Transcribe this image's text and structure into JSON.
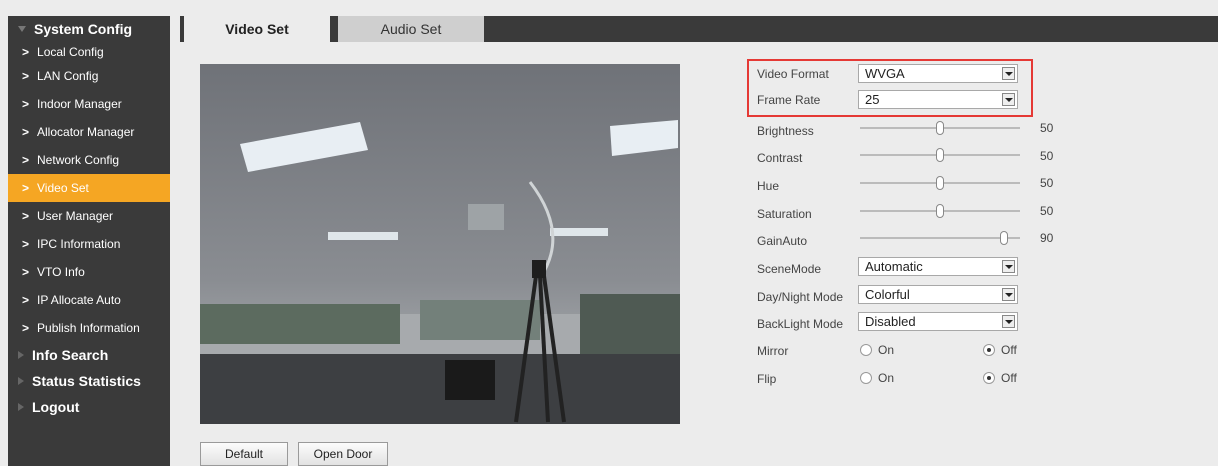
{
  "sidebar": {
    "system_config": "System Config",
    "items": [
      {
        "label": "Local Config"
      },
      {
        "label": "LAN Config"
      },
      {
        "label": "Indoor Manager"
      },
      {
        "label": "Allocator Manager"
      },
      {
        "label": "Network Config"
      },
      {
        "label": "Video Set"
      },
      {
        "label": "User Manager"
      },
      {
        "label": "IPC Information"
      },
      {
        "label": "VTO Info"
      },
      {
        "label": "IP Allocate Auto"
      },
      {
        "label": "Publish Information"
      }
    ],
    "info_search": "Info Search",
    "status_statistics": "Status Statistics",
    "logout": "Logout",
    "chevron": ">"
  },
  "tabs": {
    "video_set": "Video Set",
    "audio_set": "Audio Set"
  },
  "settings": {
    "video_format": {
      "label": "Video Format",
      "value": "WVGA"
    },
    "frame_rate": {
      "label": "Frame Rate",
      "value": "25"
    },
    "brightness": {
      "label": "Brightness",
      "value": 50,
      "display": "50"
    },
    "contrast": {
      "label": "Contrast",
      "value": 50,
      "display": "50"
    },
    "hue": {
      "label": "Hue",
      "value": 50,
      "display": "50"
    },
    "saturation": {
      "label": "Saturation",
      "value": 50,
      "display": "50"
    },
    "gain_auto": {
      "label": "GainAuto",
      "value": 90,
      "display": "90"
    },
    "scene_mode": {
      "label": "SceneMode",
      "value": "Automatic"
    },
    "day_night_mode": {
      "label": "Day/Night Mode",
      "value": "Colorful"
    },
    "backlight_mode": {
      "label": "BackLight Mode",
      "value": "Disabled"
    },
    "mirror": {
      "label": "Mirror",
      "on": "On",
      "off": "Off",
      "selected": "Off"
    },
    "flip": {
      "label": "Flip",
      "on": "On",
      "off": "Off",
      "selected": "Off"
    }
  },
  "buttons": {
    "default": "Default",
    "open_door": "Open Door"
  },
  "colors": {
    "sidebar_bg": "#3a3a3a",
    "active_item": "#f5a623",
    "highlight_border": "#e53935"
  }
}
